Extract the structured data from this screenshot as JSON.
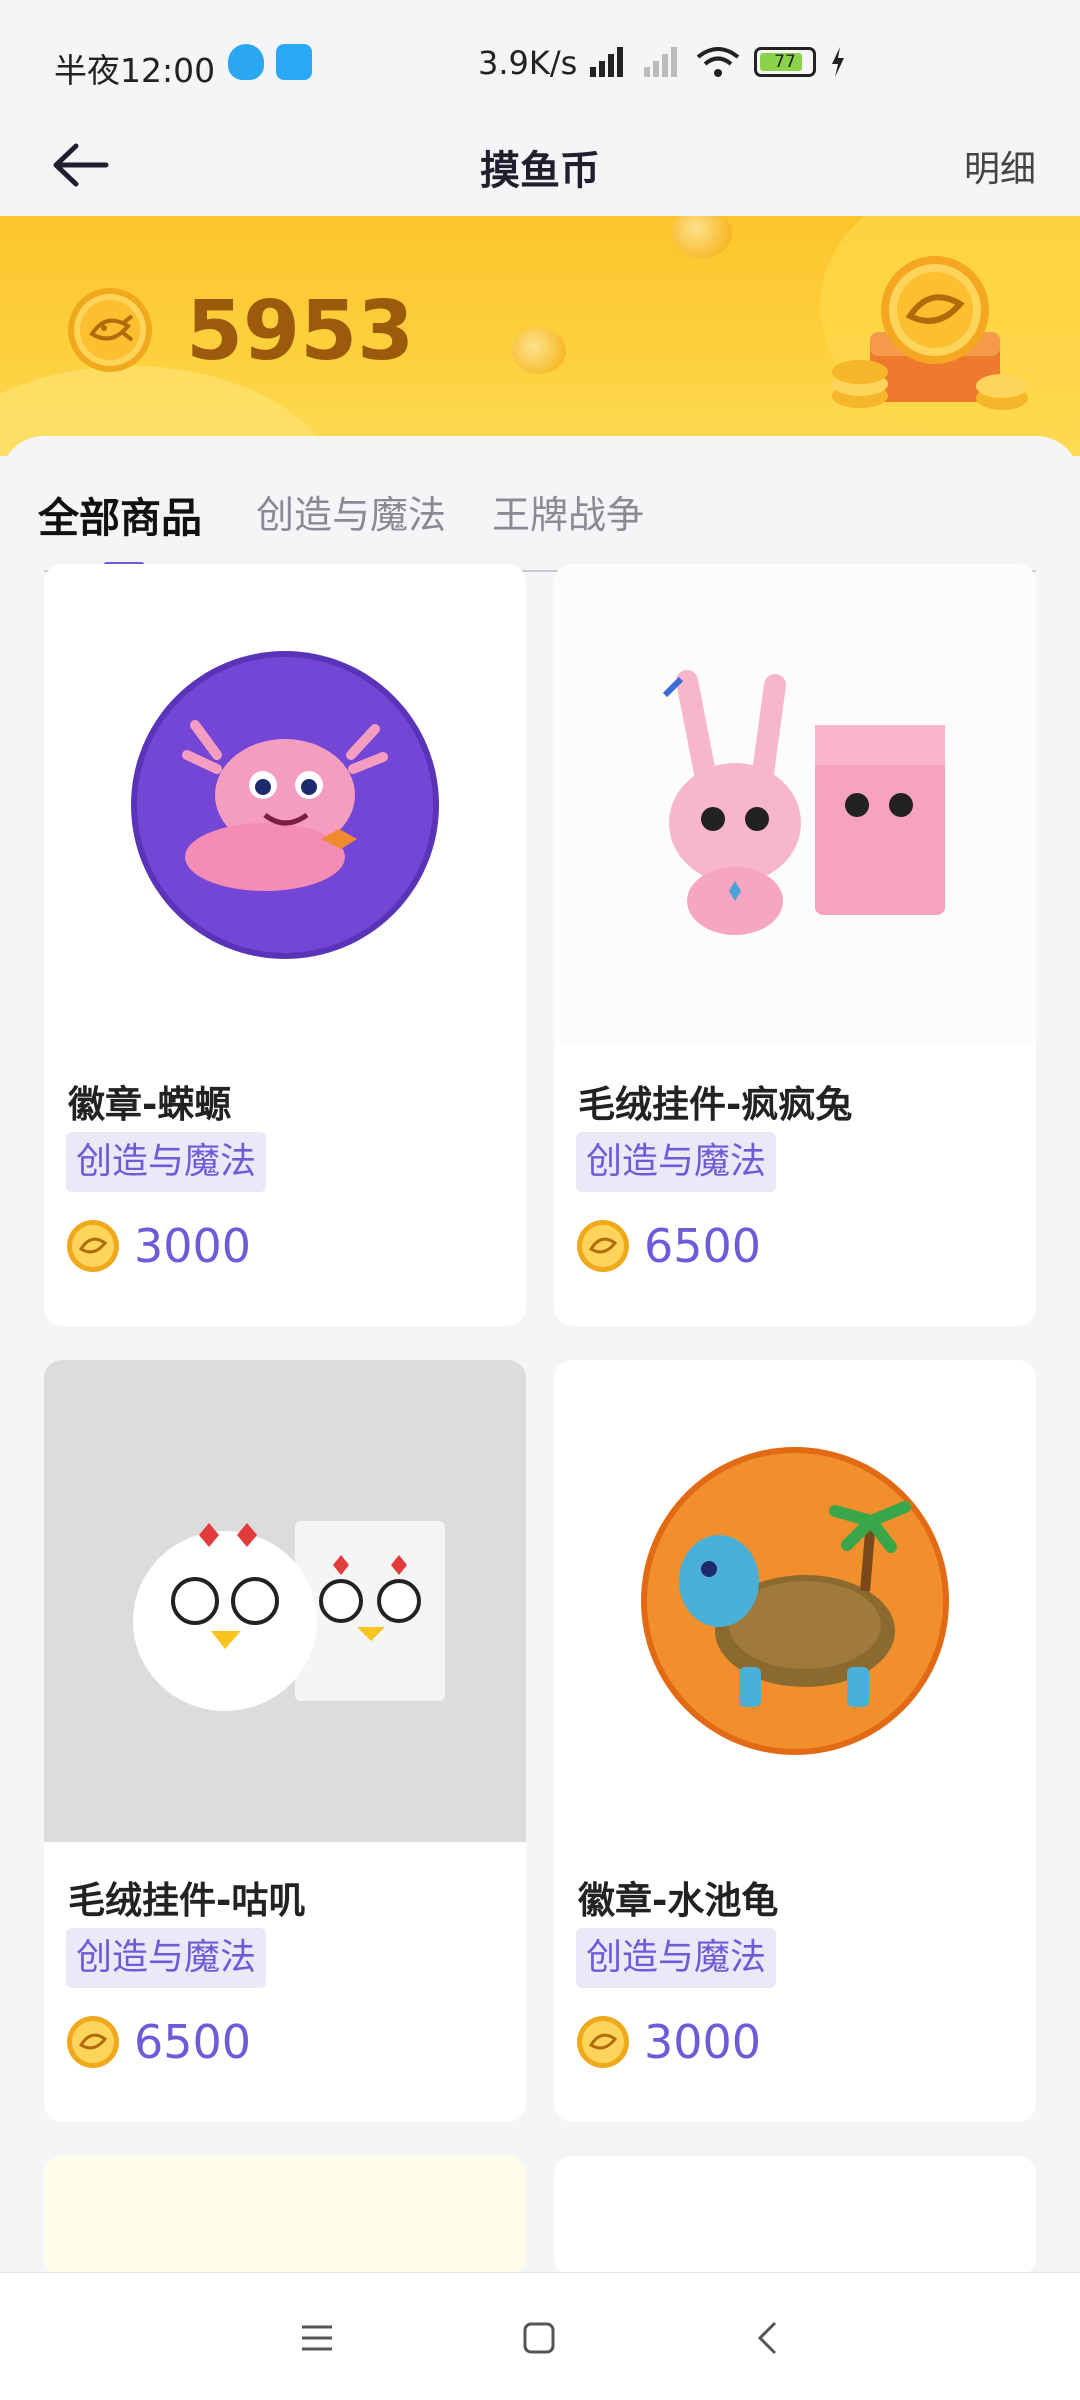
{
  "status_bar": {
    "time": "半夜12:00",
    "network_speed": "3.9K/s",
    "battery": "77"
  },
  "header": {
    "title": "摸鱼币",
    "detail_label": "明细"
  },
  "balance": {
    "amount": "5953"
  },
  "tabs": [
    {
      "label": "全部商品",
      "active": true
    },
    {
      "label": "创造与魔法",
      "active": false
    },
    {
      "label": "王牌战争",
      "active": false
    }
  ],
  "products": [
    {
      "name": "徽章-蝾螈",
      "tag": "创造与魔法",
      "price": "3000",
      "image": "axolotl-badge"
    },
    {
      "name": "毛绒挂件-疯疯兔",
      "tag": "创造与魔法",
      "price": "6500",
      "image": "bunny-plush"
    },
    {
      "name": "毛绒挂件-咕叽",
      "tag": "创造与魔法",
      "price": "6500",
      "image": "chicken-plush"
    },
    {
      "name": "徽章-水池龟",
      "tag": "创造与魔法",
      "price": "3000",
      "image": "turtle-badge"
    }
  ],
  "colors": {
    "accent": "#6d5bd8",
    "banner": "#fcc52c",
    "coin_text": "#9b5a0c"
  }
}
